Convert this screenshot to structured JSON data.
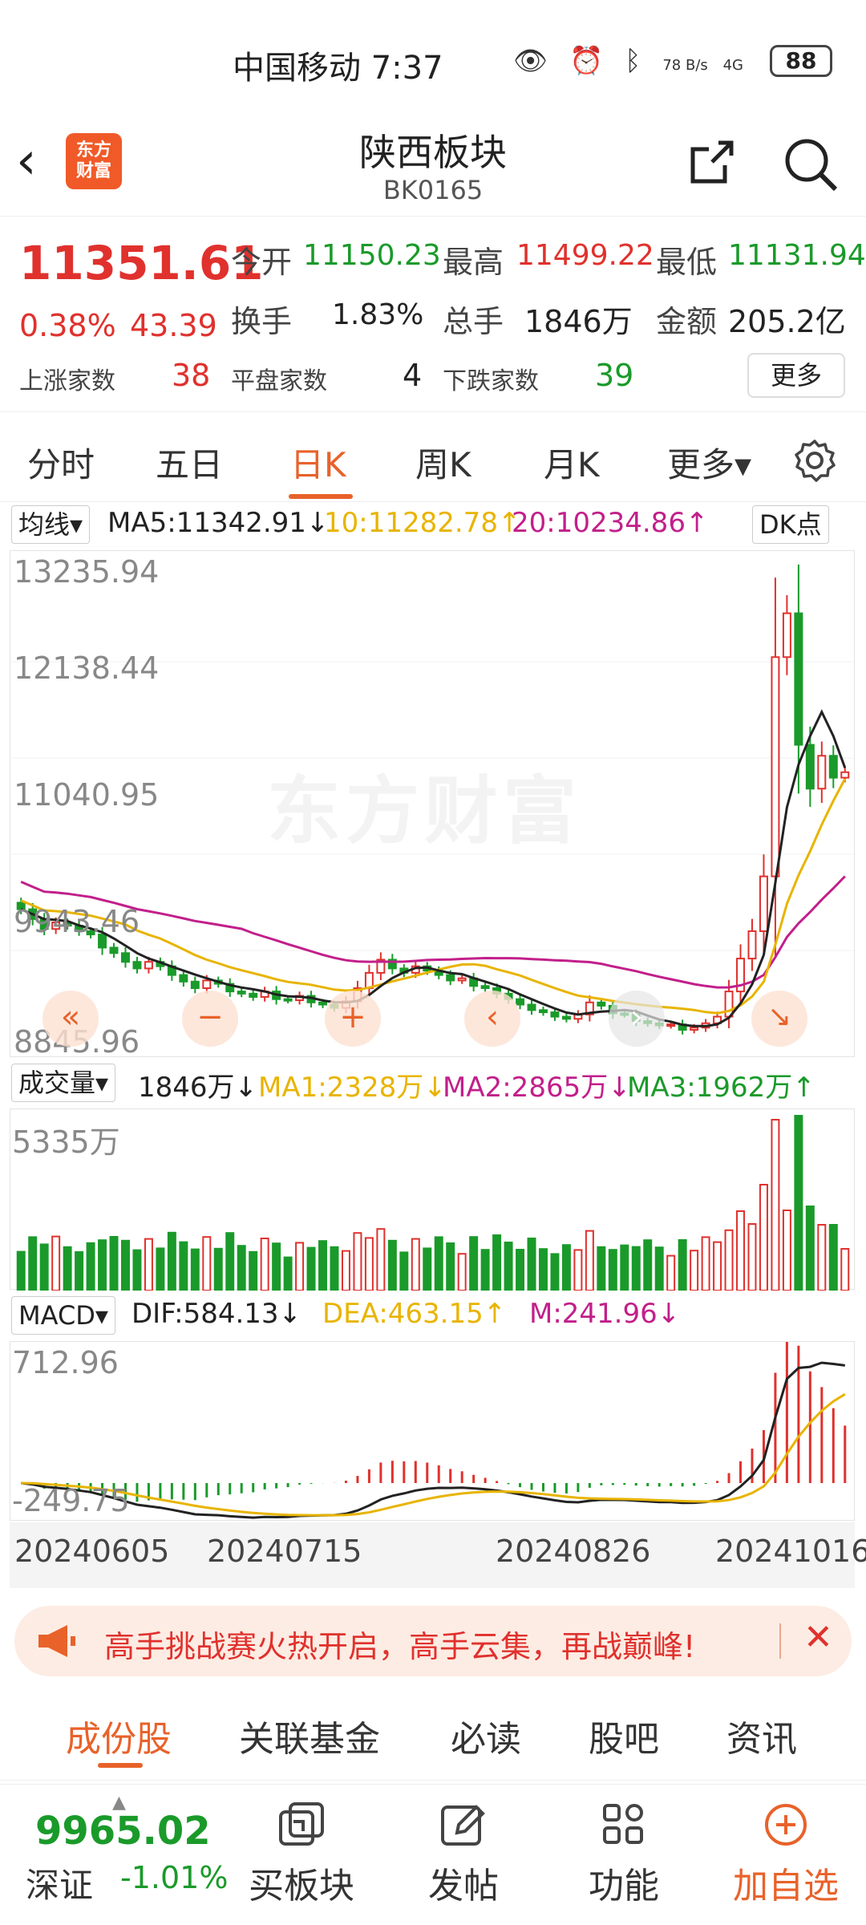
{
  "status_bar": {
    "carrier": "中国移动 7:37",
    "net_speed": "78 B/s",
    "signal": "4G",
    "battery": "88"
  },
  "header": {
    "title": "陕西板块",
    "code": "BK0165",
    "logo": "东方财富"
  },
  "quote": {
    "price": "11351.61",
    "change_pct": "0.38%",
    "change": "43.39",
    "open_label": "今开",
    "open": "11150.23",
    "high_label": "最高",
    "high": "11499.22",
    "low_label": "最低",
    "low": "11131.94",
    "turnover_label": "换手",
    "turnover": "1.83%",
    "volume_label": "总手",
    "volume": "1846万",
    "amount_label": "金额",
    "amount": "205.2亿",
    "up_label": "上涨家数",
    "up": "38",
    "flat_label": "平盘家数",
    "flat": "4",
    "down_label": "下跌家数",
    "down": "39",
    "more": "更多"
  },
  "tabs": [
    "分时",
    "五日",
    "日K",
    "周K",
    "月K",
    "更多▾"
  ],
  "ma_row": {
    "selector": "均线▾",
    "ma5": "MA5:11342.91↓",
    "ma10": "10:11282.78↑",
    "ma20": "20:10234.86↑",
    "dk": "DK点"
  },
  "kline_axis": [
    "13235.94",
    "12138.44",
    "11040.95",
    "9943.46",
    "8845.96"
  ],
  "watermark": "东方财富",
  "vol_row": {
    "selector": "成交量▾",
    "vol": "1846万↓",
    "ma1": "MA1:2328万↓",
    "ma2": "MA2:2865万↓",
    "ma3": "MA3:1962万↑"
  },
  "vol_axis": "5335万",
  "macd_row": {
    "selector": "MACD▾",
    "dif": "DIF:584.13↓",
    "dea": "DEA:463.15↑",
    "m": "M:241.96↓"
  },
  "macd_axis": [
    "712.96",
    "-249.75"
  ],
  "dates": [
    "20240605",
    "20240715",
    "20240826",
    "20241016"
  ],
  "notice": "高手挑战赛火热开启，高手云集，再战巅峰!",
  "subtabs": [
    "成份股",
    "关联基金",
    "必读",
    "股吧",
    "资讯"
  ],
  "bottom": {
    "index_value": "9965.02",
    "index_name": "深证",
    "index_change": "-1.01%",
    "items": [
      "买板块",
      "发帖",
      "功能",
      "加自选"
    ]
  },
  "colors": {
    "up": "#e0312d",
    "down": "#1a9a2a",
    "accent": "#e8622a",
    "ma5": "#222222",
    "ma10": "#e8b400",
    "ma20": "#c21f8a"
  },
  "chart_data": {
    "type": "candlestick",
    "x_dates": [
      "20240605",
      "20240715",
      "20240826",
      "20241016"
    ],
    "ylim": [
      8845.96,
      13235.94
    ],
    "close": [
      10100,
      10010,
      9920,
      9980,
      9950,
      9900,
      9870,
      9750,
      9700,
      9620,
      9560,
      9620,
      9580,
      9500,
      9440,
      9380,
      9450,
      9420,
      9350,
      9330,
      9300,
      9350,
      9280,
      9270,
      9310,
      9250,
      9230,
      9200,
      9260,
      9380,
      9520,
      9640,
      9560,
      9520,
      9580,
      9540,
      9500,
      9450,
      9470,
      9400,
      9380,
      9330,
      9280,
      9230,
      9180,
      9160,
      9120,
      9100,
      9140,
      9250,
      9220,
      9150,
      9140,
      9080,
      9060,
      9040,
      9050,
      9000,
      9020,
      9060,
      9120,
      9350,
      9650,
      9900,
      10400,
      12400,
      12800,
      11600,
      11200,
      11500,
      11300,
      11350
    ],
    "volume_axis_max": "5335万",
    "macd_range": [
      -249.75,
      712.96
    ]
  }
}
